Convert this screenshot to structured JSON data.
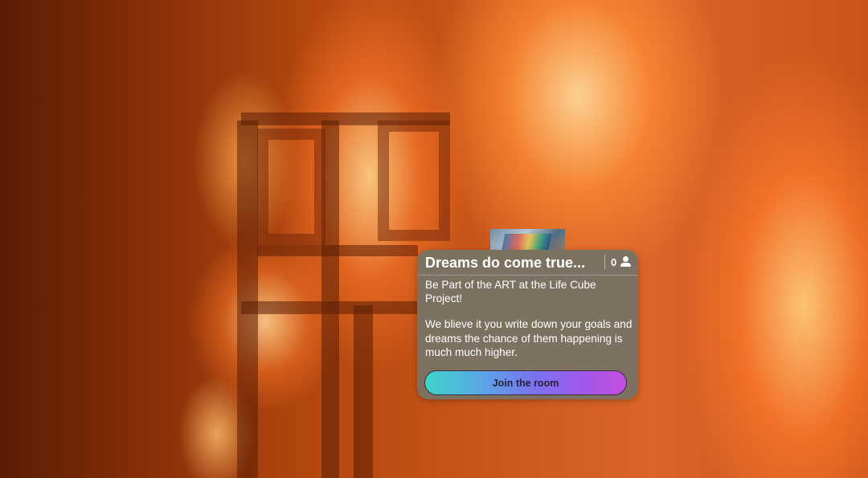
{
  "background": {
    "description_icon": "fire-background-image"
  },
  "room_card": {
    "title": "Dreams do come true...",
    "participant_count": "0",
    "participant_icon": "user-icon",
    "description_paragraphs": [
      "Be Part of the ART at the Life Cube Project!",
      "We blieve it you write down your goals and dreams the chance of them happening is much much higher."
    ],
    "join_button_label": "Join the room",
    "card_color": "#7d7161",
    "button_gradient": [
      "#3fd6c8",
      "#7a72ee",
      "#c34fe0"
    ]
  }
}
